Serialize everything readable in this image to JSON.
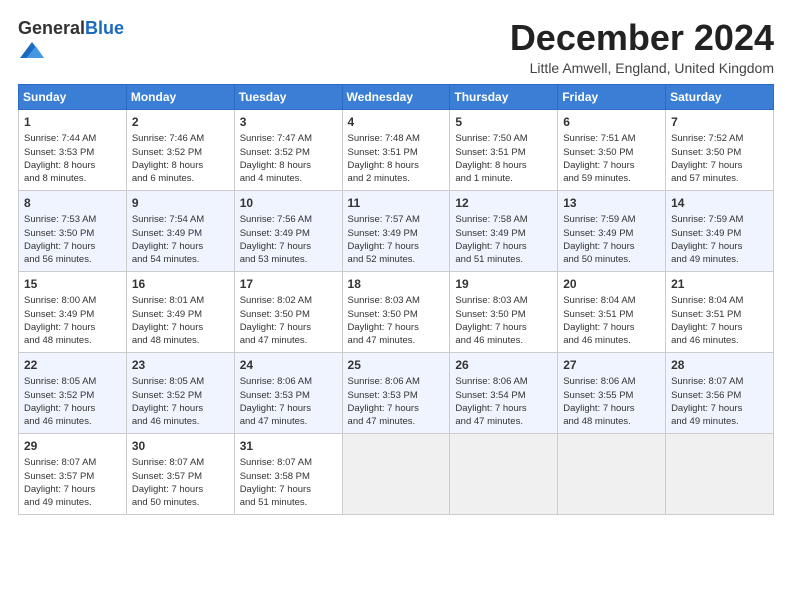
{
  "header": {
    "logo_line1": "General",
    "logo_line2": "Blue",
    "title": "December 2024",
    "location": "Little Amwell, England, United Kingdom"
  },
  "weekdays": [
    "Sunday",
    "Monday",
    "Tuesday",
    "Wednesday",
    "Thursday",
    "Friday",
    "Saturday"
  ],
  "weeks": [
    [
      {
        "day": 1,
        "info": "Sunrise: 7:44 AM\nSunset: 3:53 PM\nDaylight: 8 hours\nand 8 minutes."
      },
      {
        "day": 2,
        "info": "Sunrise: 7:46 AM\nSunset: 3:52 PM\nDaylight: 8 hours\nand 6 minutes."
      },
      {
        "day": 3,
        "info": "Sunrise: 7:47 AM\nSunset: 3:52 PM\nDaylight: 8 hours\nand 4 minutes."
      },
      {
        "day": 4,
        "info": "Sunrise: 7:48 AM\nSunset: 3:51 PM\nDaylight: 8 hours\nand 2 minutes."
      },
      {
        "day": 5,
        "info": "Sunrise: 7:50 AM\nSunset: 3:51 PM\nDaylight: 8 hours\nand 1 minute."
      },
      {
        "day": 6,
        "info": "Sunrise: 7:51 AM\nSunset: 3:50 PM\nDaylight: 7 hours\nand 59 minutes."
      },
      {
        "day": 7,
        "info": "Sunrise: 7:52 AM\nSunset: 3:50 PM\nDaylight: 7 hours\nand 57 minutes."
      }
    ],
    [
      {
        "day": 8,
        "info": "Sunrise: 7:53 AM\nSunset: 3:50 PM\nDaylight: 7 hours\nand 56 minutes."
      },
      {
        "day": 9,
        "info": "Sunrise: 7:54 AM\nSunset: 3:49 PM\nDaylight: 7 hours\nand 54 minutes."
      },
      {
        "day": 10,
        "info": "Sunrise: 7:56 AM\nSunset: 3:49 PM\nDaylight: 7 hours\nand 53 minutes."
      },
      {
        "day": 11,
        "info": "Sunrise: 7:57 AM\nSunset: 3:49 PM\nDaylight: 7 hours\nand 52 minutes."
      },
      {
        "day": 12,
        "info": "Sunrise: 7:58 AM\nSunset: 3:49 PM\nDaylight: 7 hours\nand 51 minutes."
      },
      {
        "day": 13,
        "info": "Sunrise: 7:59 AM\nSunset: 3:49 PM\nDaylight: 7 hours\nand 50 minutes."
      },
      {
        "day": 14,
        "info": "Sunrise: 7:59 AM\nSunset: 3:49 PM\nDaylight: 7 hours\nand 49 minutes."
      }
    ],
    [
      {
        "day": 15,
        "info": "Sunrise: 8:00 AM\nSunset: 3:49 PM\nDaylight: 7 hours\nand 48 minutes."
      },
      {
        "day": 16,
        "info": "Sunrise: 8:01 AM\nSunset: 3:49 PM\nDaylight: 7 hours\nand 48 minutes."
      },
      {
        "day": 17,
        "info": "Sunrise: 8:02 AM\nSunset: 3:50 PM\nDaylight: 7 hours\nand 47 minutes."
      },
      {
        "day": 18,
        "info": "Sunrise: 8:03 AM\nSunset: 3:50 PM\nDaylight: 7 hours\nand 47 minutes."
      },
      {
        "day": 19,
        "info": "Sunrise: 8:03 AM\nSunset: 3:50 PM\nDaylight: 7 hours\nand 46 minutes."
      },
      {
        "day": 20,
        "info": "Sunrise: 8:04 AM\nSunset: 3:51 PM\nDaylight: 7 hours\nand 46 minutes."
      },
      {
        "day": 21,
        "info": "Sunrise: 8:04 AM\nSunset: 3:51 PM\nDaylight: 7 hours\nand 46 minutes."
      }
    ],
    [
      {
        "day": 22,
        "info": "Sunrise: 8:05 AM\nSunset: 3:52 PM\nDaylight: 7 hours\nand 46 minutes."
      },
      {
        "day": 23,
        "info": "Sunrise: 8:05 AM\nSunset: 3:52 PM\nDaylight: 7 hours\nand 46 minutes."
      },
      {
        "day": 24,
        "info": "Sunrise: 8:06 AM\nSunset: 3:53 PM\nDaylight: 7 hours\nand 47 minutes."
      },
      {
        "day": 25,
        "info": "Sunrise: 8:06 AM\nSunset: 3:53 PM\nDaylight: 7 hours\nand 47 minutes."
      },
      {
        "day": 26,
        "info": "Sunrise: 8:06 AM\nSunset: 3:54 PM\nDaylight: 7 hours\nand 47 minutes."
      },
      {
        "day": 27,
        "info": "Sunrise: 8:06 AM\nSunset: 3:55 PM\nDaylight: 7 hours\nand 48 minutes."
      },
      {
        "day": 28,
        "info": "Sunrise: 8:07 AM\nSunset: 3:56 PM\nDaylight: 7 hours\nand 49 minutes."
      }
    ],
    [
      {
        "day": 29,
        "info": "Sunrise: 8:07 AM\nSunset: 3:57 PM\nDaylight: 7 hours\nand 49 minutes."
      },
      {
        "day": 30,
        "info": "Sunrise: 8:07 AM\nSunset: 3:57 PM\nDaylight: 7 hours\nand 50 minutes."
      },
      {
        "day": 31,
        "info": "Sunrise: 8:07 AM\nSunset: 3:58 PM\nDaylight: 7 hours\nand 51 minutes."
      },
      null,
      null,
      null,
      null
    ]
  ]
}
